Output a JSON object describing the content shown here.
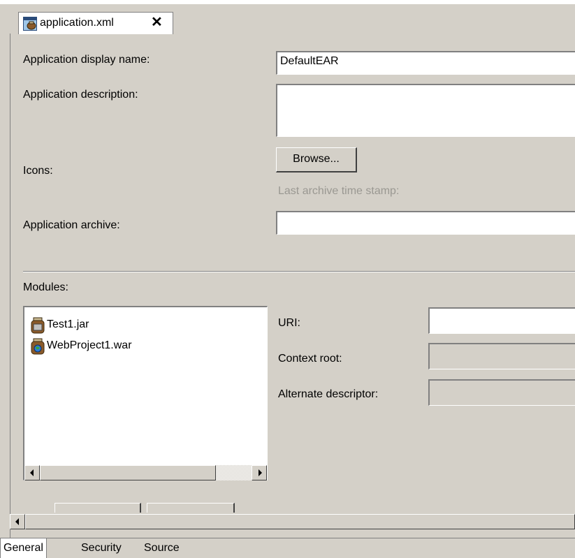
{
  "editor_tab": {
    "label": "application.xml",
    "close_glyph": "✕",
    "icon": "ear-file-icon"
  },
  "form": {
    "display_name": {
      "label": "Application display name:",
      "value": "DefaultEAR"
    },
    "description": {
      "label": "Application description:",
      "value": ""
    },
    "icons": {
      "label": "Icons:",
      "button": "Browse..."
    },
    "timestamp_label": "Last archive time stamp:",
    "archive": {
      "label": "Application archive:",
      "value": ""
    }
  },
  "modules": {
    "label": "Modules:",
    "items": [
      {
        "name": "Test1.jar",
        "icon": "jar-module-icon"
      },
      {
        "name": "WebProject1.war",
        "icon": "war-module-icon"
      }
    ],
    "uri": {
      "label": "URI:",
      "value": ""
    },
    "context_root": {
      "label": "Context root:",
      "value": ""
    },
    "alternate_descriptor": {
      "label": "Alternate descriptor:",
      "value": ""
    }
  },
  "page_tabs": [
    {
      "label": "General",
      "active": true
    },
    {
      "label": "Security",
      "active": false
    },
    {
      "label": "Source",
      "active": false
    }
  ],
  "colors": {
    "background": "#d4d0c8",
    "shadow": "#808080",
    "highlight": "#ffffff",
    "disabled_text": "#9a9892"
  }
}
